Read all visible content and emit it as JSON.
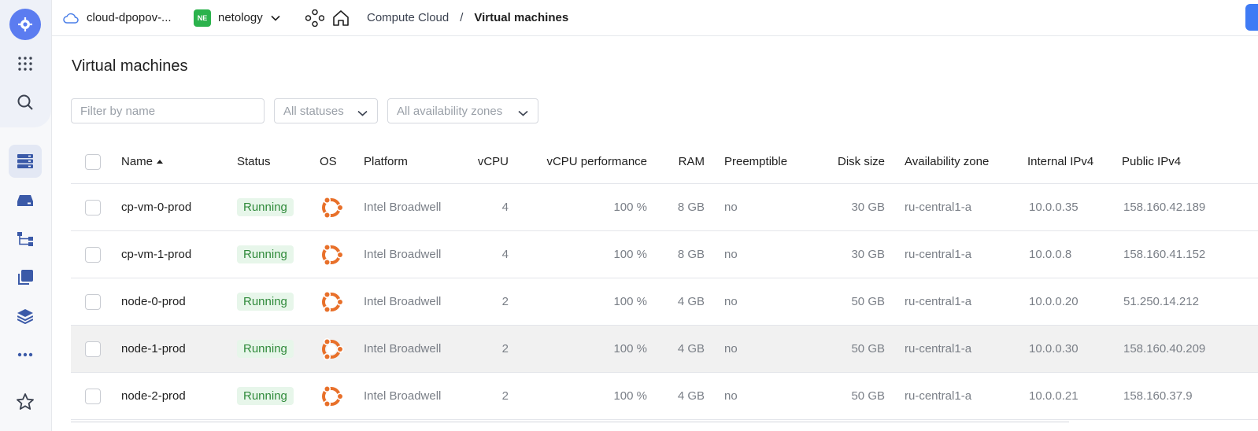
{
  "header": {
    "cloud_name": "cloud-dpopov-...",
    "folder_badge": "NE",
    "folder_name": "netology",
    "breadcrumb_service": "Compute Cloud",
    "breadcrumb_separator": "/",
    "breadcrumb_current": "Virtual machines"
  },
  "page": {
    "title": "Virtual machines"
  },
  "filters": {
    "name_placeholder": "Filter by name",
    "status_select": "All statuses",
    "zone_select": "All availability zones"
  },
  "table": {
    "columns": {
      "name": "Name",
      "status": "Status",
      "os": "OS",
      "platform": "Platform",
      "vcpu": "vCPU",
      "vcpu_perf": "vCPU performance",
      "ram": "RAM",
      "preemptible": "Preemptible",
      "disk": "Disk size",
      "zone": "Availability zone",
      "ipv4_internal": "Internal IPv4",
      "ipv4_public": "Public IPv4"
    },
    "rows": [
      {
        "name": "cp-vm-0-prod",
        "status": "Running",
        "platform": "Intel Broadwell",
        "vcpu": "4",
        "perf": "100 %",
        "ram": "8 GB",
        "preemptible": "no",
        "disk": "30 GB",
        "zone": "ru-central1-a",
        "internal": "10.0.0.35",
        "public": "158.160.42.189",
        "highlighted": false
      },
      {
        "name": "cp-vm-1-prod",
        "status": "Running",
        "platform": "Intel Broadwell",
        "vcpu": "4",
        "perf": "100 %",
        "ram": "8 GB",
        "preemptible": "no",
        "disk": "30 GB",
        "zone": "ru-central1-a",
        "internal": "10.0.0.8",
        "public": "158.160.41.152",
        "highlighted": false
      },
      {
        "name": "node-0-prod",
        "status": "Running",
        "platform": "Intel Broadwell",
        "vcpu": "2",
        "perf": "100 %",
        "ram": "4 GB",
        "preemptible": "no",
        "disk": "50 GB",
        "zone": "ru-central1-a",
        "internal": "10.0.0.20",
        "public": "51.250.14.212",
        "highlighted": false
      },
      {
        "name": "node-1-prod",
        "status": "Running",
        "platform": "Intel Broadwell",
        "vcpu": "2",
        "perf": "100 %",
        "ram": "4 GB",
        "preemptible": "no",
        "disk": "50 GB",
        "zone": "ru-central1-a",
        "internal": "10.0.0.30",
        "public": "158.160.40.209",
        "highlighted": true
      },
      {
        "name": "node-2-prod",
        "status": "Running",
        "platform": "Intel Broadwell",
        "vcpu": "2",
        "perf": "100 %",
        "ram": "4 GB",
        "preemptible": "no",
        "disk": "50 GB",
        "zone": "ru-central1-a",
        "internal": "10.0.0.21",
        "public": "158.160.37.9",
        "highlighted": false
      }
    ]
  },
  "icons": {
    "os": "ubuntu-icon",
    "os_color": "#e8702a",
    "status_running_color": "#2f8a3a",
    "accent": "#5b7cf0"
  }
}
